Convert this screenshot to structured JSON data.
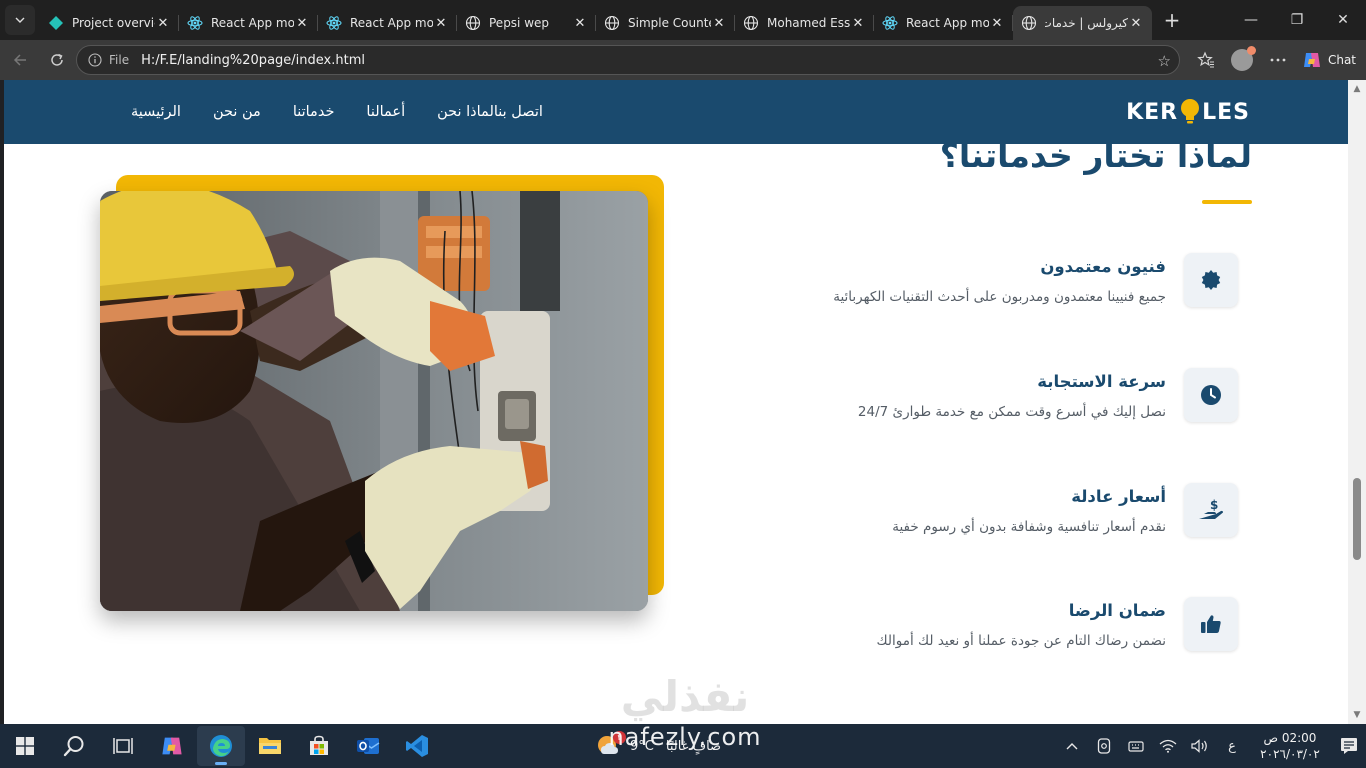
{
  "browser": {
    "tabs": [
      {
        "title": "Project overview",
        "icon": "diamond-app-icon",
        "active": false
      },
      {
        "title": "React App moo",
        "icon": "react-icon",
        "active": false
      },
      {
        "title": "React App moo",
        "icon": "react-icon",
        "active": false
      },
      {
        "title": "Pepsi wep",
        "icon": "globe-icon",
        "active": false
      },
      {
        "title": "Simple Counter",
        "icon": "globe-icon",
        "active": false
      },
      {
        "title": "Mohamed Essa",
        "icon": "globe-icon",
        "active": false
      },
      {
        "title": "React App moo",
        "icon": "react-icon",
        "active": false
      },
      {
        "title": "كيرولس | خدمات",
        "icon": "globe-icon",
        "active": true
      }
    ],
    "close_glyph": "✕",
    "new_tab_glyph": "+",
    "address": {
      "scheme_label": "File",
      "url": "H:/F.E/landing%20page/index.html"
    },
    "chat_label": "Chat",
    "window_controls": {
      "minimize": "—",
      "maximize": "❐",
      "close": "✕"
    }
  },
  "site": {
    "logo": {
      "left": "KER",
      "right": "LES"
    },
    "nav": [
      {
        "label": "الرئيسية"
      },
      {
        "label": "من نحن"
      },
      {
        "label": "خدماتنا"
      },
      {
        "label": "أعمالنا"
      },
      {
        "label": "لماذا نحن"
      },
      {
        "label": "اتصل بنا"
      }
    ],
    "section_title": "لماذا تختار خدماتنا؟",
    "features": [
      {
        "title": "فنيون معتمدون",
        "desc": "جميع فنيينا معتمدون ومدربون على أحدث التقنيات الكهربائية",
        "icon": "certificate-badge-icon"
      },
      {
        "title": "سرعة الاستجابة",
        "desc": "نصل إليك في أسرع وقت ممكن مع خدمة طوارئ 24/7",
        "icon": "clock-icon"
      },
      {
        "title": "أسعار عادلة",
        "desc": "نقدم أسعار تنافسية وشفافة بدون أي رسوم خفية",
        "icon": "hand-holding-dollar-icon"
      },
      {
        "title": "ضمان الرضا",
        "desc": "نضمن رضاك التام عن جودة عملنا أو نعيد لك أموالك",
        "icon": "thumbs-up-icon"
      }
    ],
    "colors": {
      "primary": "#1a4a6e",
      "accent": "#f2b705"
    }
  },
  "watermark": {
    "arabic": "نفذلي",
    "latin": "nafezly.com"
  },
  "taskbar": {
    "apps": [
      "windows-start-icon",
      "search-icon",
      "task-view-icon",
      "copilot-icon",
      "edge-icon",
      "file-explorer-icon",
      "store-icon",
      "outlook-icon",
      "vscode-icon"
    ],
    "weather": {
      "temp": "9°C",
      "desc": "صافٍ غالبًا",
      "badge": "٢"
    },
    "input_lang": "ع",
    "clock": {
      "time": "02:00 ص",
      "date": "٢٠٢٦/٠٣/٠٢"
    }
  }
}
